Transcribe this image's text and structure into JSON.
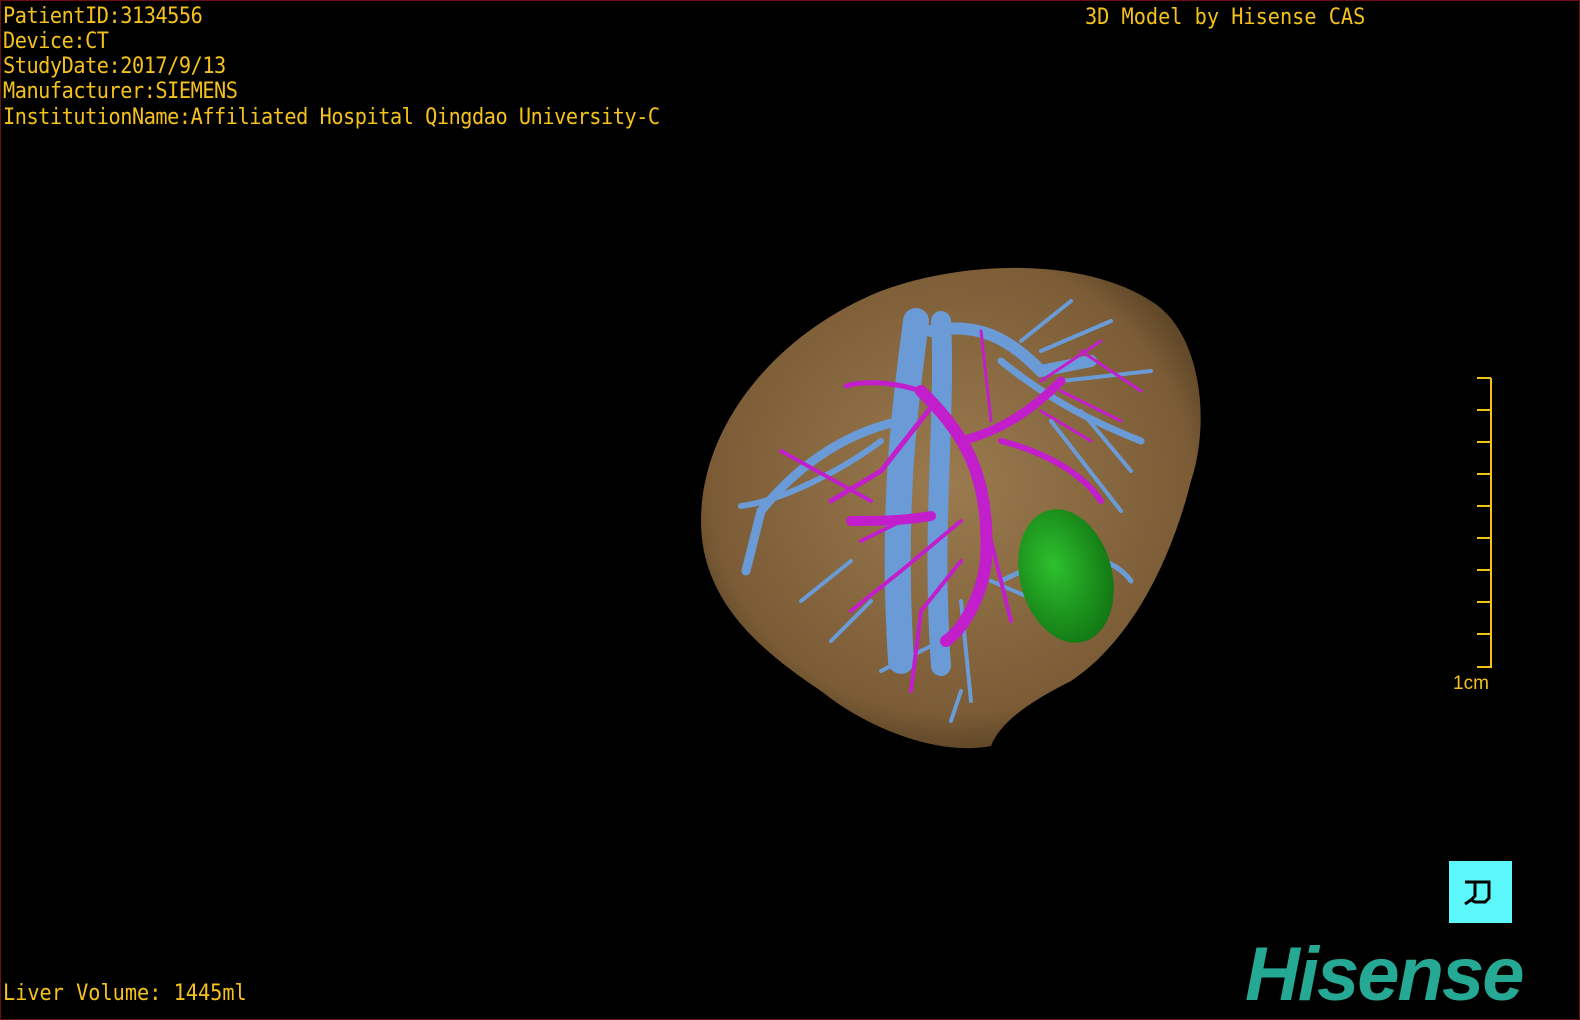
{
  "info": {
    "patient_id": "PatientID:3134556",
    "device": "Device:CT",
    "study_date": "StudyDate:2017/9/13",
    "manufacturer": "Manufacturer:SIEMENS",
    "institution": "InstitutionName:Affiliated Hospital Qingdao University-C"
  },
  "credit": "3D Model by Hisense CAS",
  "liver_volume": "Liver Volume: 1445ml",
  "scale_label": "1cm",
  "logo": "Hisense",
  "colors": {
    "text": "#f5c21b",
    "liver": "#8a6a42",
    "portal_vein": "#6a9bd6",
    "hepatic_vein": "#c21ecc",
    "tumor": "#1ea01e",
    "logo": "#25a894",
    "orientation": "#5cf7fb"
  }
}
